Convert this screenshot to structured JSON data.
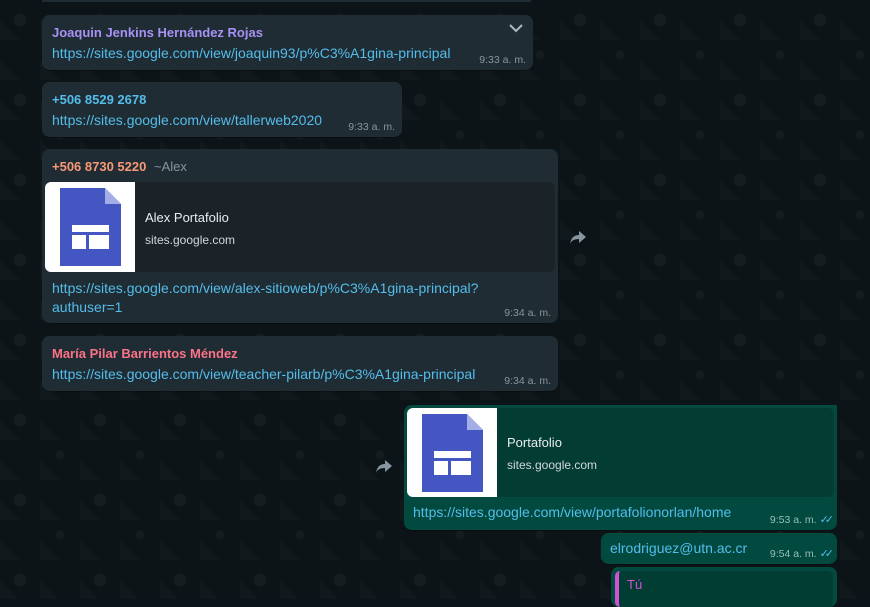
{
  "colors": {
    "incoming_bubble": "#202c33",
    "outgoing_bubble": "#024a3f",
    "link": "#53bdeb",
    "sender_purple": "#a791f5",
    "sender_blue": "#53bdeb",
    "sender_orange": "#f79877",
    "sender_red": "#fc7288",
    "quote_magenta": "#d352d3"
  },
  "messages": [
    {
      "sender": "Joaquin Jenkins Hernández Rojas",
      "text": "https://sites.google.com/view/joaquin93/p%C3%A1gina-principal",
      "time": "9:33 a. m."
    },
    {
      "sender": "+506 8529 2678",
      "text": "https://sites.google.com/view/tallerweb2020",
      "time": "9:33 a. m."
    },
    {
      "sender": "+506 8730 5220",
      "sender_alias": "~Alex",
      "preview_title": "Alex Portafolio",
      "preview_domain": "sites.google.com",
      "text_line1": "https://sites.google.com/view/alex-sitioweb/p%C3%A1gina-principal?",
      "text_line2": "authuser=1",
      "time": "9:34 a. m."
    },
    {
      "sender": "María Pilar Barrientos Méndez",
      "text": "https://sites.google.com/view/teacher-pilarb/p%C3%A1gina-principal",
      "time": "9:34 a. m."
    },
    {
      "preview_title": "Portafolio",
      "preview_domain": "sites.google.com",
      "text": "https://sites.google.com/view/portafolionorlan/home",
      "time": "9:53 a. m."
    },
    {
      "text": "elrodriguez@utn.ac.cr",
      "time": "9:54 a. m."
    },
    {
      "quote_author": "Tú"
    }
  ],
  "icons": {
    "tick": "✓✓",
    "forward": "➦",
    "chevron": "⌄"
  }
}
